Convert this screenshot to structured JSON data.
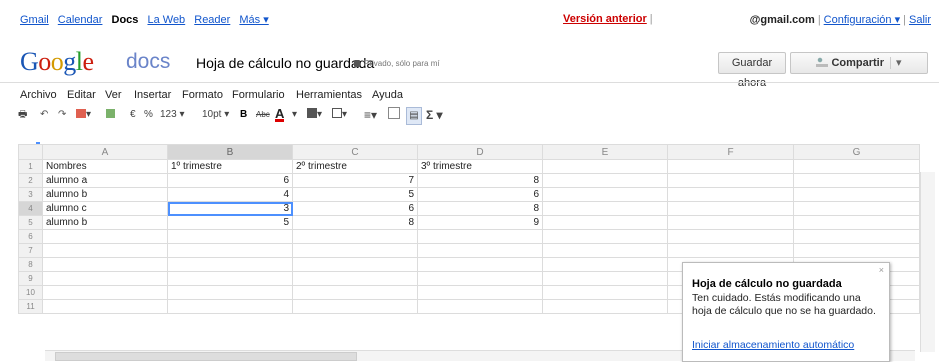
{
  "nav": {
    "links": [
      "Gmail",
      "Calendar",
      "Docs",
      "La Web",
      "Reader",
      "Más ▾"
    ],
    "version_link": "Versión anterior",
    "account": "@gmail.com",
    "settings": "Configuración ▾",
    "signout": "Salir"
  },
  "title_bar": {
    "logo_docs": "docs",
    "doc_title": "Hoja de cálculo no guardada",
    "privacy": "Privado, sólo para mí",
    "save_button": "Guardar ahora",
    "share_button": "Compartir"
  },
  "menu": [
    "Archivo",
    "Editar",
    "Ver",
    "Insertar",
    "Formato",
    "Formulario",
    "Herramientas",
    "Ayuda"
  ],
  "toolbar": {
    "currency": "€",
    "percent": "%",
    "number_format": "123 ▾",
    "font_size": "10pt ▾",
    "bold": "B",
    "strike": "Abc",
    "text_color": "A",
    "sum": "Σ ▾"
  },
  "sheet": {
    "columns": [
      "A",
      "B",
      "C",
      "D",
      "E",
      "F",
      "G"
    ],
    "row_numbers": [
      "1",
      "2",
      "3",
      "4",
      "5",
      "6",
      "7",
      "8",
      "9",
      "10",
      "11"
    ],
    "rows": [
      [
        "Nombres",
        "1º trimestre",
        "2º trimestre",
        "3º trimestre",
        "",
        "",
        ""
      ],
      [
        "alumno a",
        "6",
        "7",
        "8",
        "",
        "",
        ""
      ],
      [
        "alumno b",
        "4",
        "5",
        "6",
        "",
        "",
        ""
      ],
      [
        "alumno c",
        "3",
        "6",
        "8",
        "",
        "",
        ""
      ],
      [
        "alumno b",
        "5",
        "8",
        "9",
        "",
        "",
        ""
      ],
      [
        "",
        "",
        "",
        "",
        "",
        "",
        ""
      ],
      [
        "",
        "",
        "",
        "",
        "",
        "",
        ""
      ],
      [
        "",
        "",
        "",
        "",
        "",
        "",
        ""
      ],
      [
        "",
        "",
        "",
        "",
        "",
        "",
        ""
      ],
      [
        "",
        "",
        "",
        "",
        "",
        "",
        ""
      ],
      [
        "",
        "",
        "",
        "",
        "",
        "",
        ""
      ]
    ]
  },
  "bubble": {
    "title": "Hoja de cálculo no guardada",
    "body": "Ten cuidado. Estás modificando una hoja de cálculo que no se ha guardado.",
    "link": "Iniciar almacenamiento automático",
    "close": "×"
  }
}
